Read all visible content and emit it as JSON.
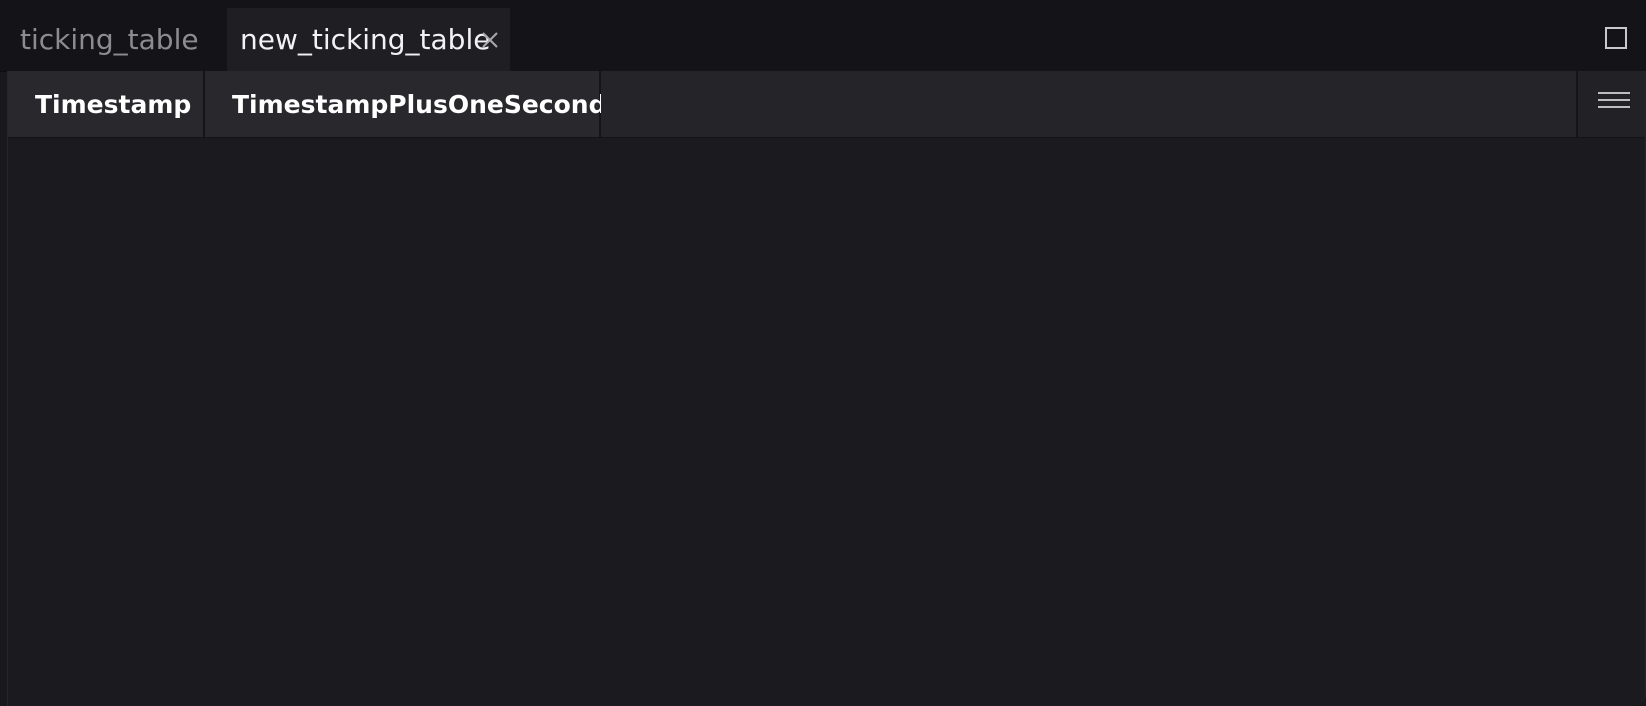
{
  "tabs": [
    {
      "label": "ticking_table",
      "active": false
    },
    {
      "label": "new_ticking_table",
      "active": true
    }
  ],
  "table": {
    "columns": [
      "Timestamp",
      "TimestampPlusOneSecond"
    ]
  },
  "icons": {
    "tab_close": "close-icon",
    "maximize": "maximize-icon",
    "column_menu": "hamburger-menu-icon"
  },
  "colors": {
    "background": "#19181c",
    "tab_bar": "#141317",
    "active_tab": "#1f1e23",
    "header": "#29282d",
    "text_active": "#f2f2f4",
    "text_inactive": "#8c8b91"
  }
}
